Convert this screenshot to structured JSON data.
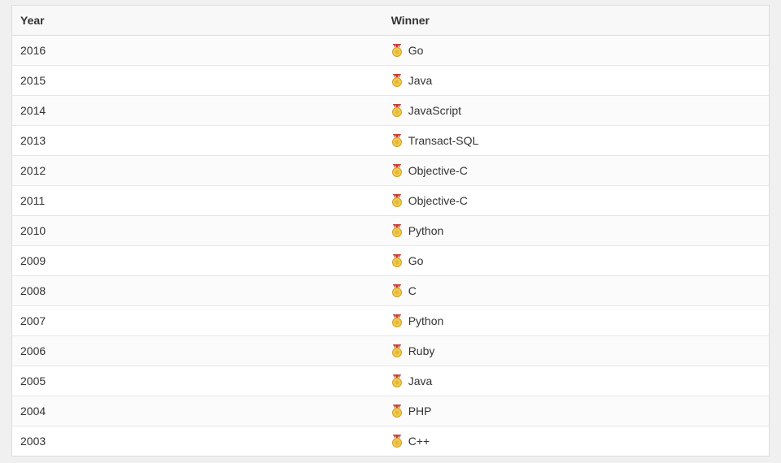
{
  "table": {
    "headers": {
      "year": "Year",
      "winner": "Winner"
    },
    "rows": [
      {
        "year": "2016",
        "winner": "Go"
      },
      {
        "year": "2015",
        "winner": "Java"
      },
      {
        "year": "2014",
        "winner": "JavaScript"
      },
      {
        "year": "2013",
        "winner": "Transact-SQL"
      },
      {
        "year": "2012",
        "winner": "Objective-C"
      },
      {
        "year": "2011",
        "winner": "Objective-C"
      },
      {
        "year": "2010",
        "winner": "Python"
      },
      {
        "year": "2009",
        "winner": "Go"
      },
      {
        "year": "2008",
        "winner": "C"
      },
      {
        "year": "2007",
        "winner": "Python"
      },
      {
        "year": "2006",
        "winner": "Ruby"
      },
      {
        "year": "2005",
        "winner": "Java"
      },
      {
        "year": "2004",
        "winner": "PHP"
      },
      {
        "year": "2003",
        "winner": "C++"
      }
    ]
  }
}
